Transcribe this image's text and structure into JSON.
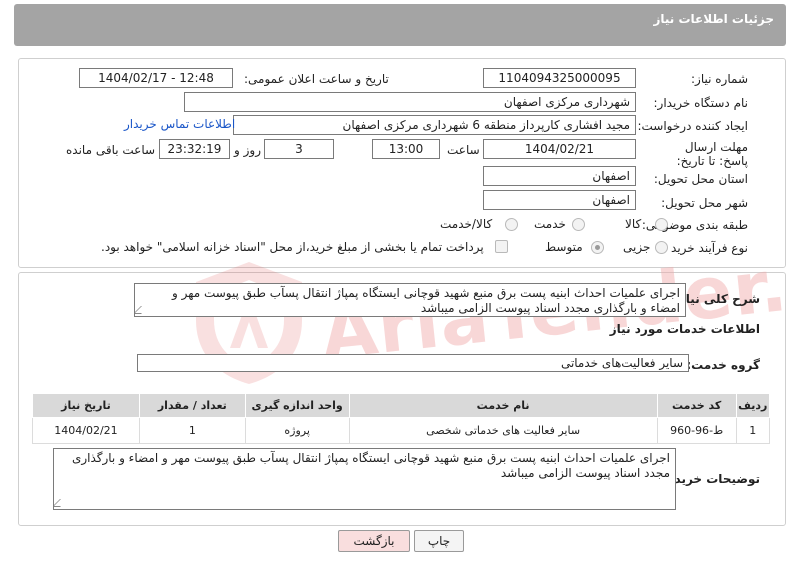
{
  "header": {
    "title": "جزئیات اطلاعات نیاز"
  },
  "labels": {
    "need_number": "شماره نیاز:",
    "announce_datetime": "تاریخ و ساعت اعلان عمومی:",
    "buyer_org": "نام دستگاه خریدار:",
    "requester": "ایجاد کننده درخواست:",
    "deadline": "مهلت ارسال پاسخ: تا تاریخ:",
    "time_word": "ساعت",
    "day_and": "روز و",
    "remaining": "ساعت باقی مانده",
    "province": "استان محل تحویل:",
    "city": "شهر محل تحویل:",
    "category": "طبقه بندی موضوعی:",
    "process_type": "نوع فرآیند خرید :",
    "description": "شرح کلی نیاز:",
    "services_info": "اطلاعات خدمات مورد نیاز",
    "service_group": "گروه خدمت:",
    "buyer_notes": "توضیحات خریدار:"
  },
  "values": {
    "need_number": "1104094325000095",
    "announce_datetime": "1404/02/17 - 12:48",
    "buyer_org": "شهرداری مرکزی اصفهان",
    "requester": "مجید افشاری کارپرداز منطقه 6 شهرداری مرکزی اصفهان",
    "contact_link": "اطلاعات تماس خریدار",
    "deadline_date": "1404/02/21",
    "deadline_time": "13:00",
    "days": "3",
    "remaining_time": "23:32:19",
    "province": "اصفهان",
    "city": "اصفهان",
    "description": "اجرای علمیات احداث ابنیه پست برق منبع شهید قوچانی ایستگاه پمپاژ انتقال پسآب طبق پیوست مهر و امضاء و بارگذاری مجدد اسناد پیوست الزامی میباشد",
    "service_group": "سایر فعالیت‌های خدماتی",
    "buyer_notes": "اجرای علمیات احداث ابنیه پست برق منبع شهید قوچانی ایستگاه پمپاژ انتقال پسآب طبق پیوست مهر و امضاء و بارگذاری مجدد اسناد پیوست الزامی میباشد"
  },
  "category_options": [
    {
      "label": "کالا",
      "selected": false
    },
    {
      "label": "خدمت",
      "selected": false
    },
    {
      "label": "کالا/خدمت",
      "selected": false
    }
  ],
  "process_options": [
    {
      "label": "جزیی",
      "selected": false
    },
    {
      "label": "متوسط",
      "selected": true
    }
  ],
  "payment_note": "پرداخت تمام یا بخشی از مبلغ خرید،از محل \"اسناد خزانه اسلامی\" خواهد بود.",
  "table": {
    "headers": [
      "ردیف",
      "کد خدمت",
      "نام خدمت",
      "واحد اندازه گیری",
      "تعداد / مقدار",
      "تاریخ نیاز"
    ],
    "rows": [
      [
        "1",
        "ط-96-960",
        "سایر فعالیت های خدماتی شخصی",
        "پروژه",
        "1",
        "1404/02/21"
      ]
    ]
  },
  "buttons": {
    "print": "چاپ",
    "back": "بازگشت"
  },
  "colors": {
    "header_bg": "#a4a4a4",
    "link": "#1a56c8",
    "back_button_bg": "#f9dede",
    "table_header_bg": "#d9d9d9"
  },
  "watermark": "AriaTender.net"
}
